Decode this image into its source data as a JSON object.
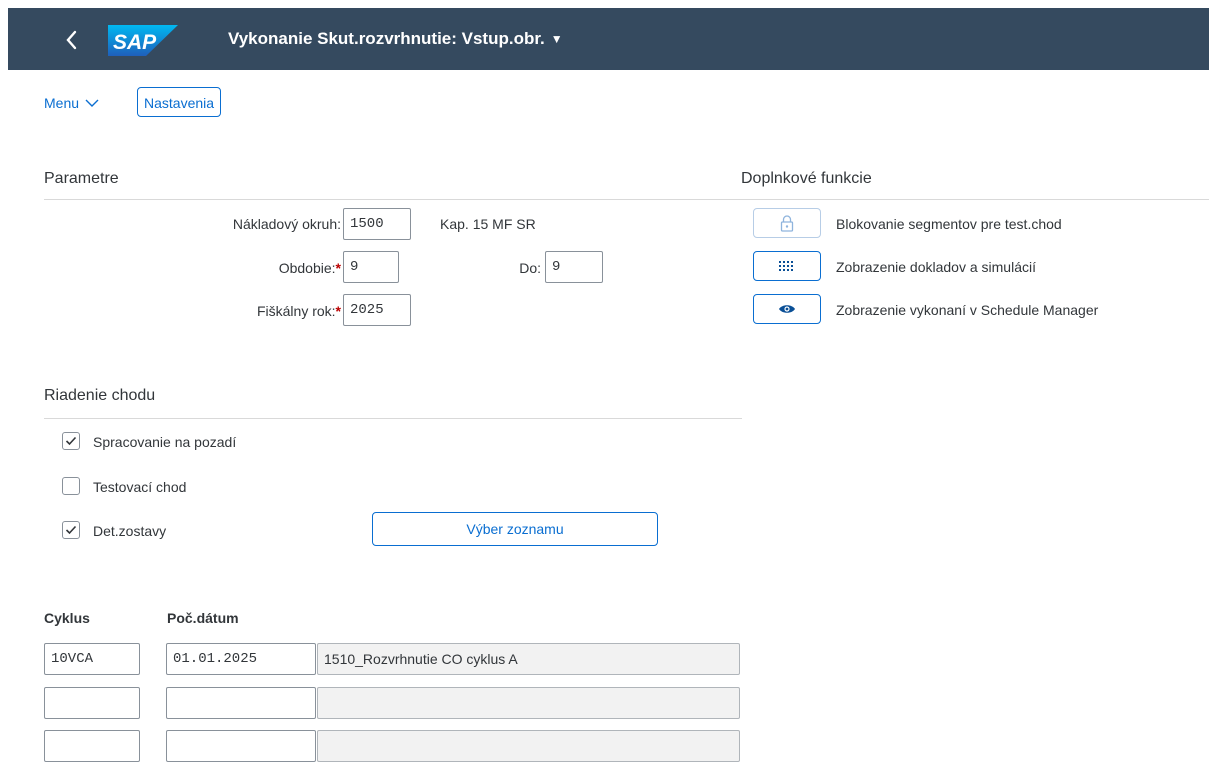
{
  "shell": {
    "title": "Vykonanie Skut.rozvrhnutie: Vstup.obr.",
    "logo_text": "SAP"
  },
  "toolbar": {
    "menu_label": "Menu",
    "settings_label": "Nastavenia"
  },
  "parameters": {
    "title": "Parametre",
    "cost_center_label": "Nákladový okruh:",
    "cost_center_value": "1500",
    "cost_center_desc": "Kap. 15 MF SR",
    "period_label": "Obdobie:",
    "period_value": "9",
    "to_label": "Do:",
    "to_value": "9",
    "fiscal_year_label": "Fiškálny rok:",
    "fiscal_year_value": "2025",
    "required_mark": "*"
  },
  "extra_functions": {
    "title": "Doplnkové funkcie",
    "items": [
      {
        "label": "Blokovanie segmentov pre test.chod",
        "icon": "lock-icon"
      },
      {
        "label": "Zobrazenie dokladov a simulácií",
        "icon": "documents-icon"
      },
      {
        "label": "Zobrazenie vykonaní v Schedule Manager",
        "icon": "eye-icon"
      }
    ]
  },
  "run_control": {
    "title": "Riadenie chodu",
    "background_processing": {
      "label": "Spracovanie na pozadí",
      "checked": true
    },
    "test_run": {
      "label": "Testovací chod",
      "checked": false
    },
    "detail_lists": {
      "label": "Det.zostavy",
      "checked": true
    },
    "list_selection_button": "Výber zoznamu"
  },
  "cycles": {
    "col_cycle": "Cyklus",
    "col_start_date": "Poč.dátum",
    "rows": [
      {
        "cycle": "10VCA",
        "start_date": "01.01.2025",
        "description": "1510_Rozvrhnutie CO cyklus A"
      },
      {
        "cycle": "",
        "start_date": "",
        "description": ""
      },
      {
        "cycle": "",
        "start_date": "",
        "description": ""
      }
    ]
  },
  "colors": {
    "shell_bg": "#354a5f",
    "accent": "#0a6ed1",
    "required": "#bb0000"
  }
}
